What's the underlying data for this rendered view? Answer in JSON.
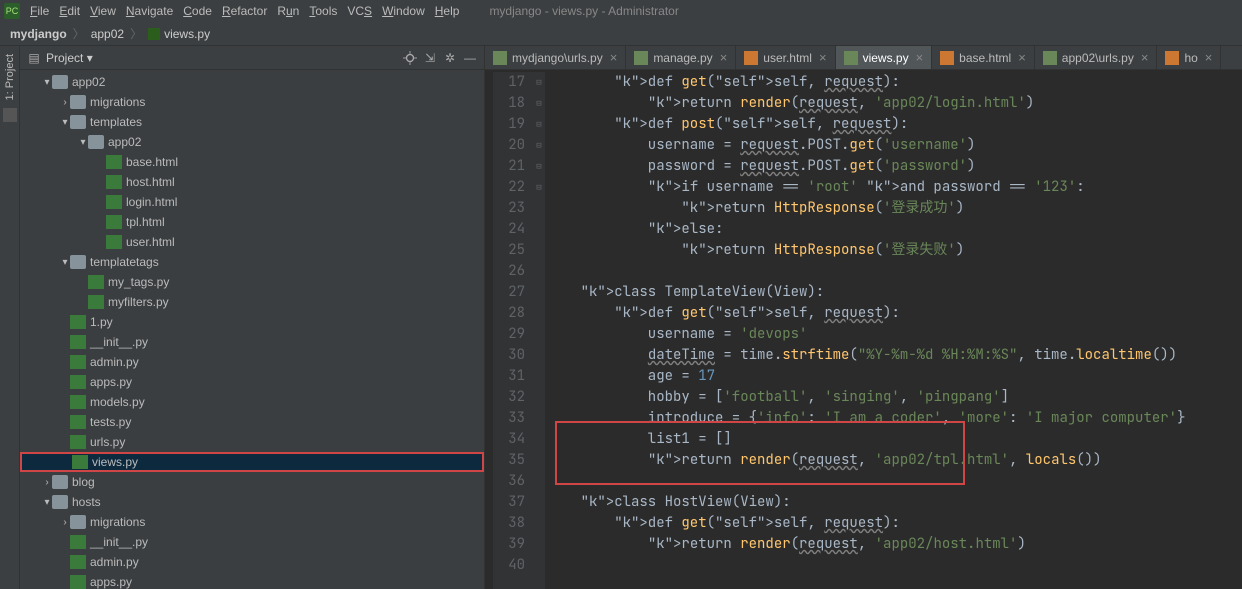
{
  "window_title": "mydjango - views.py - Administrator",
  "menu": [
    "File",
    "Edit",
    "View",
    "Navigate",
    "Code",
    "Refactor",
    "Run",
    "Tools",
    "VCS",
    "Window",
    "Help"
  ],
  "breadcrumb": [
    "mydjango",
    "app02",
    "views.py"
  ],
  "project_pane": {
    "title": "Project"
  },
  "left_rail": {
    "label": "1: Project"
  },
  "tree": [
    {
      "depth": 1,
      "arrow": "▾",
      "icon": "folder-open",
      "label": "app02"
    },
    {
      "depth": 2,
      "arrow": "›",
      "icon": "folder-open",
      "label": "migrations"
    },
    {
      "depth": 2,
      "arrow": "▾",
      "icon": "folder-open",
      "label": "templates"
    },
    {
      "depth": 3,
      "arrow": "▾",
      "icon": "folder-open",
      "label": "app02"
    },
    {
      "depth": 4,
      "arrow": "",
      "icon": "html",
      "label": "base.html"
    },
    {
      "depth": 4,
      "arrow": "",
      "icon": "html",
      "label": "host.html"
    },
    {
      "depth": 4,
      "arrow": "",
      "icon": "html",
      "label": "login.html"
    },
    {
      "depth": 4,
      "arrow": "",
      "icon": "html",
      "label": "tpl.html"
    },
    {
      "depth": 4,
      "arrow": "",
      "icon": "html",
      "label": "user.html"
    },
    {
      "depth": 2,
      "arrow": "▾",
      "icon": "folder-open",
      "label": "templatetags"
    },
    {
      "depth": 3,
      "arrow": "",
      "icon": "py",
      "label": "my_tags.py"
    },
    {
      "depth": 3,
      "arrow": "",
      "icon": "py",
      "label": "myfilters.py"
    },
    {
      "depth": 2,
      "arrow": "",
      "icon": "py",
      "label": "1.py"
    },
    {
      "depth": 2,
      "arrow": "",
      "icon": "py",
      "label": "__init__.py"
    },
    {
      "depth": 2,
      "arrow": "",
      "icon": "py",
      "label": "admin.py"
    },
    {
      "depth": 2,
      "arrow": "",
      "icon": "py",
      "label": "apps.py"
    },
    {
      "depth": 2,
      "arrow": "",
      "icon": "py",
      "label": "models.py"
    },
    {
      "depth": 2,
      "arrow": "",
      "icon": "py",
      "label": "tests.py"
    },
    {
      "depth": 2,
      "arrow": "",
      "icon": "py",
      "label": "urls.py"
    },
    {
      "depth": 2,
      "arrow": "",
      "icon": "py",
      "label": "views.py",
      "selected": true,
      "highlight": true
    },
    {
      "depth": 1,
      "arrow": "›",
      "icon": "folder-open",
      "label": "blog"
    },
    {
      "depth": 1,
      "arrow": "▾",
      "icon": "folder-open",
      "label": "hosts"
    },
    {
      "depth": 2,
      "arrow": "›",
      "icon": "folder-open",
      "label": "migrations"
    },
    {
      "depth": 2,
      "arrow": "",
      "icon": "py",
      "label": "__init__.py"
    },
    {
      "depth": 2,
      "arrow": "",
      "icon": "py",
      "label": "admin.py"
    },
    {
      "depth": 2,
      "arrow": "",
      "icon": "py",
      "label": "apps.py"
    }
  ],
  "tabs": [
    {
      "icon": "py",
      "label": "mydjango\\urls.py",
      "active": false
    },
    {
      "icon": "py",
      "label": "manage.py",
      "active": false
    },
    {
      "icon": "html",
      "label": "user.html",
      "active": false
    },
    {
      "icon": "py",
      "label": "views.py",
      "active": true
    },
    {
      "icon": "html",
      "label": "base.html",
      "active": false
    },
    {
      "icon": "py",
      "label": "app02\\urls.py",
      "active": false
    },
    {
      "icon": "html",
      "label": "ho",
      "active": false
    }
  ],
  "code": {
    "first_line": 17,
    "lines": [
      "        def get(self, request):",
      "            return render(request, 'app02/login.html')",
      "        def post(self, request):",
      "            username = request.POST.get('username')",
      "            password = request.POST.get('password')",
      "            if username == 'root' and password == '123':",
      "                return HttpResponse('登录成功')",
      "            else:",
      "                return HttpResponse('登录失败')",
      "",
      "    class TemplateView(View):",
      "        def get(self, request):",
      "            username = 'devops'",
      "            dateTime = time.strftime(\"%Y-%m-%d %H:%M:%S\", time.localtime())",
      "            age = 17",
      "            hobby = ['football', 'singing', 'pingpang']",
      "            introduce = {'info': 'I am a coder', 'more': 'I major computer'}",
      "            list1 = []",
      "            return render(request, 'app02/tpl.html', locals())",
      "",
      "    class HostView(View):",
      "        def get(self, request):",
      "            return render(request, 'app02/host.html')",
      ""
    ]
  }
}
